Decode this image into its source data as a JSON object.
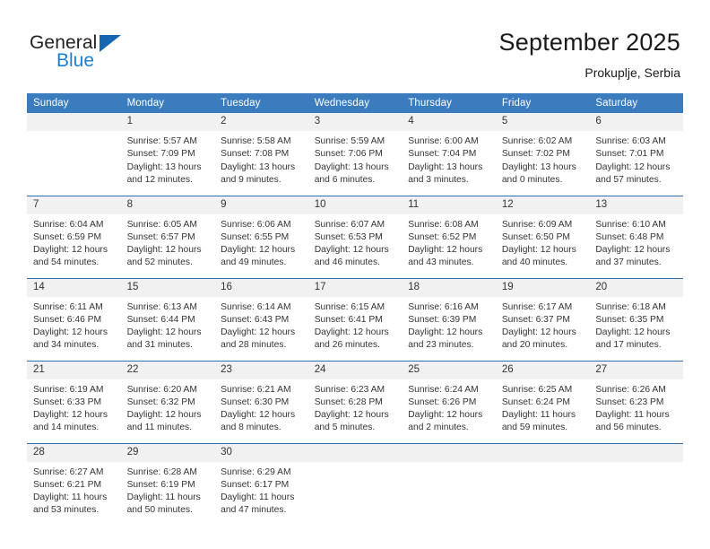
{
  "brand": {
    "name_top": "General",
    "name_bottom": "Blue",
    "triangle_color": "#1565b0",
    "blue_color": "#1b7fd4"
  },
  "header": {
    "title": "September 2025",
    "location": "Prokuplje, Serbia"
  },
  "theme": {
    "header_bg": "#3a7cbe",
    "day_band_bg": "#f1f1f1",
    "row_border": "#2f6fad"
  },
  "weekday_headers": [
    "Sunday",
    "Monday",
    "Tuesday",
    "Wednesday",
    "Thursday",
    "Friday",
    "Saturday"
  ],
  "weeks": [
    [
      {
        "day": "",
        "empty": true,
        "sunrise": "",
        "sunset": "",
        "daylight_1": "",
        "daylight_2": ""
      },
      {
        "day": "1",
        "sunrise": "Sunrise: 5:57 AM",
        "sunset": "Sunset: 7:09 PM",
        "daylight_1": "Daylight: 13 hours",
        "daylight_2": "and 12 minutes."
      },
      {
        "day": "2",
        "sunrise": "Sunrise: 5:58 AM",
        "sunset": "Sunset: 7:08 PM",
        "daylight_1": "Daylight: 13 hours",
        "daylight_2": "and 9 minutes."
      },
      {
        "day": "3",
        "sunrise": "Sunrise: 5:59 AM",
        "sunset": "Sunset: 7:06 PM",
        "daylight_1": "Daylight: 13 hours",
        "daylight_2": "and 6 minutes."
      },
      {
        "day": "4",
        "sunrise": "Sunrise: 6:00 AM",
        "sunset": "Sunset: 7:04 PM",
        "daylight_1": "Daylight: 13 hours",
        "daylight_2": "and 3 minutes."
      },
      {
        "day": "5",
        "sunrise": "Sunrise: 6:02 AM",
        "sunset": "Sunset: 7:02 PM",
        "daylight_1": "Daylight: 13 hours",
        "daylight_2": "and 0 minutes."
      },
      {
        "day": "6",
        "sunrise": "Sunrise: 6:03 AM",
        "sunset": "Sunset: 7:01 PM",
        "daylight_1": "Daylight: 12 hours",
        "daylight_2": "and 57 minutes."
      }
    ],
    [
      {
        "day": "7",
        "sunrise": "Sunrise: 6:04 AM",
        "sunset": "Sunset: 6:59 PM",
        "daylight_1": "Daylight: 12 hours",
        "daylight_2": "and 54 minutes."
      },
      {
        "day": "8",
        "sunrise": "Sunrise: 6:05 AM",
        "sunset": "Sunset: 6:57 PM",
        "daylight_1": "Daylight: 12 hours",
        "daylight_2": "and 52 minutes."
      },
      {
        "day": "9",
        "sunrise": "Sunrise: 6:06 AM",
        "sunset": "Sunset: 6:55 PM",
        "daylight_1": "Daylight: 12 hours",
        "daylight_2": "and 49 minutes."
      },
      {
        "day": "10",
        "sunrise": "Sunrise: 6:07 AM",
        "sunset": "Sunset: 6:53 PM",
        "daylight_1": "Daylight: 12 hours",
        "daylight_2": "and 46 minutes."
      },
      {
        "day": "11",
        "sunrise": "Sunrise: 6:08 AM",
        "sunset": "Sunset: 6:52 PM",
        "daylight_1": "Daylight: 12 hours",
        "daylight_2": "and 43 minutes."
      },
      {
        "day": "12",
        "sunrise": "Sunrise: 6:09 AM",
        "sunset": "Sunset: 6:50 PM",
        "daylight_1": "Daylight: 12 hours",
        "daylight_2": "and 40 minutes."
      },
      {
        "day": "13",
        "sunrise": "Sunrise: 6:10 AM",
        "sunset": "Sunset: 6:48 PM",
        "daylight_1": "Daylight: 12 hours",
        "daylight_2": "and 37 minutes."
      }
    ],
    [
      {
        "day": "14",
        "sunrise": "Sunrise: 6:11 AM",
        "sunset": "Sunset: 6:46 PM",
        "daylight_1": "Daylight: 12 hours",
        "daylight_2": "and 34 minutes."
      },
      {
        "day": "15",
        "sunrise": "Sunrise: 6:13 AM",
        "sunset": "Sunset: 6:44 PM",
        "daylight_1": "Daylight: 12 hours",
        "daylight_2": "and 31 minutes."
      },
      {
        "day": "16",
        "sunrise": "Sunrise: 6:14 AM",
        "sunset": "Sunset: 6:43 PM",
        "daylight_1": "Daylight: 12 hours",
        "daylight_2": "and 28 minutes."
      },
      {
        "day": "17",
        "sunrise": "Sunrise: 6:15 AM",
        "sunset": "Sunset: 6:41 PM",
        "daylight_1": "Daylight: 12 hours",
        "daylight_2": "and 26 minutes."
      },
      {
        "day": "18",
        "sunrise": "Sunrise: 6:16 AM",
        "sunset": "Sunset: 6:39 PM",
        "daylight_1": "Daylight: 12 hours",
        "daylight_2": "and 23 minutes."
      },
      {
        "day": "19",
        "sunrise": "Sunrise: 6:17 AM",
        "sunset": "Sunset: 6:37 PM",
        "daylight_1": "Daylight: 12 hours",
        "daylight_2": "and 20 minutes."
      },
      {
        "day": "20",
        "sunrise": "Sunrise: 6:18 AM",
        "sunset": "Sunset: 6:35 PM",
        "daylight_1": "Daylight: 12 hours",
        "daylight_2": "and 17 minutes."
      }
    ],
    [
      {
        "day": "21",
        "sunrise": "Sunrise: 6:19 AM",
        "sunset": "Sunset: 6:33 PM",
        "daylight_1": "Daylight: 12 hours",
        "daylight_2": "and 14 minutes."
      },
      {
        "day": "22",
        "sunrise": "Sunrise: 6:20 AM",
        "sunset": "Sunset: 6:32 PM",
        "daylight_1": "Daylight: 12 hours",
        "daylight_2": "and 11 minutes."
      },
      {
        "day": "23",
        "sunrise": "Sunrise: 6:21 AM",
        "sunset": "Sunset: 6:30 PM",
        "daylight_1": "Daylight: 12 hours",
        "daylight_2": "and 8 minutes."
      },
      {
        "day": "24",
        "sunrise": "Sunrise: 6:23 AM",
        "sunset": "Sunset: 6:28 PM",
        "daylight_1": "Daylight: 12 hours",
        "daylight_2": "and 5 minutes."
      },
      {
        "day": "25",
        "sunrise": "Sunrise: 6:24 AM",
        "sunset": "Sunset: 6:26 PM",
        "daylight_1": "Daylight: 12 hours",
        "daylight_2": "and 2 minutes."
      },
      {
        "day": "26",
        "sunrise": "Sunrise: 6:25 AM",
        "sunset": "Sunset: 6:24 PM",
        "daylight_1": "Daylight: 11 hours",
        "daylight_2": "and 59 minutes."
      },
      {
        "day": "27",
        "sunrise": "Sunrise: 6:26 AM",
        "sunset": "Sunset: 6:23 PM",
        "daylight_1": "Daylight: 11 hours",
        "daylight_2": "and 56 minutes."
      }
    ],
    [
      {
        "day": "28",
        "sunrise": "Sunrise: 6:27 AM",
        "sunset": "Sunset: 6:21 PM",
        "daylight_1": "Daylight: 11 hours",
        "daylight_2": "and 53 minutes."
      },
      {
        "day": "29",
        "sunrise": "Sunrise: 6:28 AM",
        "sunset": "Sunset: 6:19 PM",
        "daylight_1": "Daylight: 11 hours",
        "daylight_2": "and 50 minutes."
      },
      {
        "day": "30",
        "sunrise": "Sunrise: 6:29 AM",
        "sunset": "Sunset: 6:17 PM",
        "daylight_1": "Daylight: 11 hours",
        "daylight_2": "and 47 minutes."
      },
      {
        "day": "",
        "empty": true,
        "sunrise": "",
        "sunset": "",
        "daylight_1": "",
        "daylight_2": ""
      },
      {
        "day": "",
        "empty": true,
        "sunrise": "",
        "sunset": "",
        "daylight_1": "",
        "daylight_2": ""
      },
      {
        "day": "",
        "empty": true,
        "sunrise": "",
        "sunset": "",
        "daylight_1": "",
        "daylight_2": ""
      },
      {
        "day": "",
        "empty": true,
        "sunrise": "",
        "sunset": "",
        "daylight_1": "",
        "daylight_2": ""
      }
    ]
  ]
}
